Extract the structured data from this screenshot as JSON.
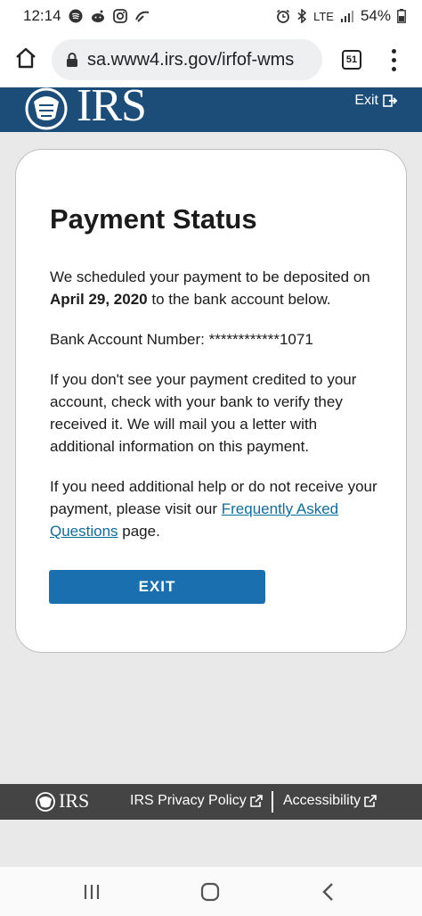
{
  "status_bar": {
    "time": "12:14",
    "network": "LTE",
    "battery": "54%"
  },
  "browser": {
    "url": "sa.www4.irs.gov/irfof-wms",
    "tab_count": "51"
  },
  "header": {
    "logo_text": "IRS",
    "exit_label": "Exit"
  },
  "card": {
    "title": "Payment Status",
    "para1_prefix": "We scheduled your payment to be deposited on ",
    "para1_date": "April 29, 2020",
    "para1_suffix": " to the bank account below.",
    "bank_account": "Bank Account Number: ************1071",
    "para3": "If you don't see your payment credited to your account, check with your bank to verify they received it. We will mail you a letter with additional information on this payment.",
    "para4_prefix": "If you need additional help or do not receive your payment, please visit our ",
    "faq_link": "Frequently Asked Questions",
    "para4_suffix": " page.",
    "exit_button": "EXIT"
  },
  "footer": {
    "logo_text": "IRS",
    "privacy_link": "IRS Privacy Policy",
    "accessibility_link": "Accessibility"
  },
  "colors": {
    "header_blue": "#1c4c78",
    "button_blue": "#1a6fae",
    "link_blue": "#0f6d9c",
    "footer_gray": "#444444"
  }
}
